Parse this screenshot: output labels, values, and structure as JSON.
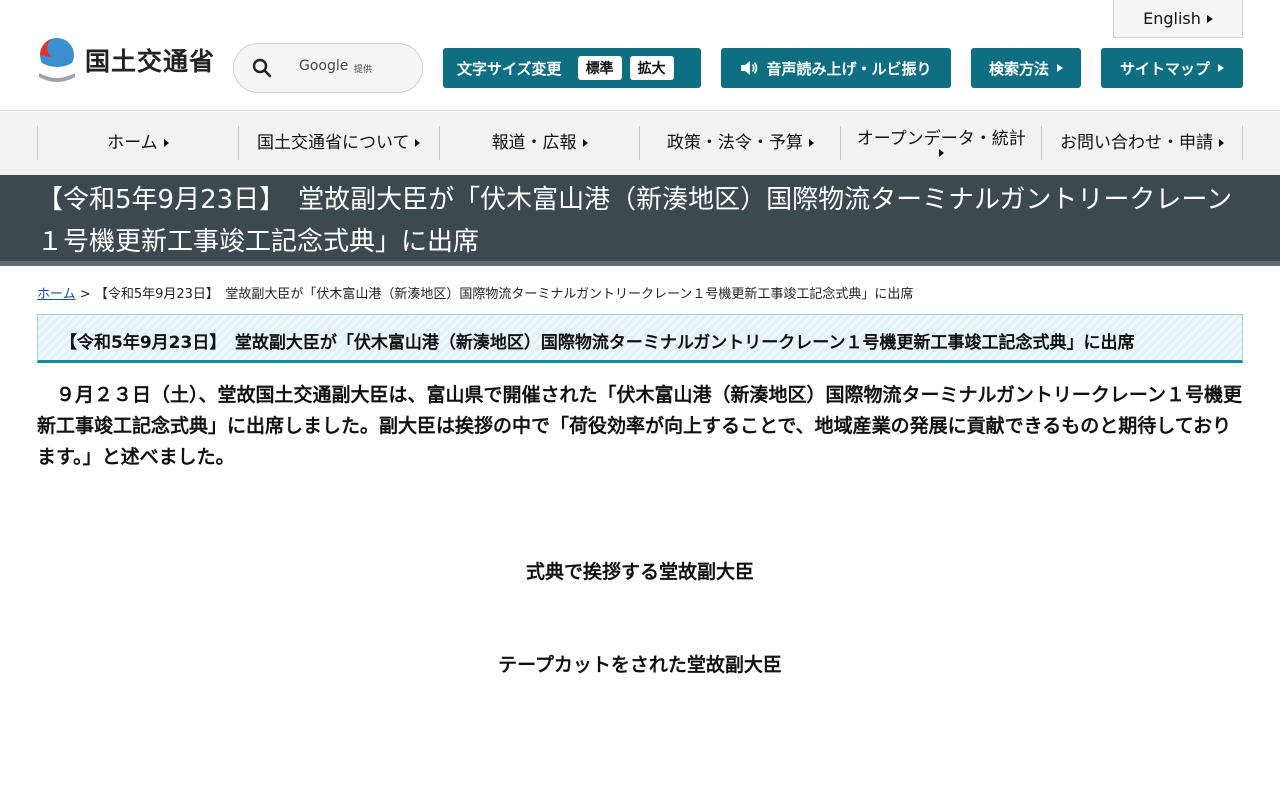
{
  "header": {
    "logo_text": "国土交通省",
    "search": {
      "brand": "Google",
      "provided": "提供"
    },
    "language_button": "English",
    "font_size": {
      "label": "文字サイズ変更",
      "standard": "標準",
      "large": "拡大"
    },
    "voice_button": "音声読み上げ・ルビ振り",
    "search_method_button": "検索方法",
    "sitemap_button": "サイトマップ"
  },
  "nav": {
    "items": [
      {
        "label": "ホーム"
      },
      {
        "label": "国土交通省について"
      },
      {
        "label": "報道・広報"
      },
      {
        "label": "政策・法令・予算"
      },
      {
        "label": "オープンデータ・統計"
      },
      {
        "label": "お問い合わせ・申請"
      }
    ]
  },
  "page": {
    "title": "【令和5年9月23日】　堂故副大臣が「伏木富山港（新湊地区）国際物流ターミナルガントリークレーン１号機更新工事竣工記念式典」に出席",
    "breadcrumb": {
      "home": "ホーム",
      "separator": ">",
      "current": "【令和5年9月23日】　堂故副大臣が「伏木富山港（新湊地区）国際物流ターミナルガントリークレーン１号機更新工事竣工記念式典」に出席"
    },
    "section_heading": "【令和5年9月23日】　堂故副大臣が「伏木富山港（新湊地区）国際物流ターミナルガントリークレーン１号機更新工事竣工記念式典」に出席",
    "body": "９月２３日（土）、堂故国土交通副大臣は、富山県で開催された「伏木富山港（新湊地区）国際物流ターミナルガントリークレーン１号機更新工事竣工記念式典」に出席しました。副大臣は挨拶の中で「荷役効率が向上することで、地域産業の発展に貢献できるものと期待しております。」と述べました。",
    "captions": [
      "式典で挨拶する堂故副大臣",
      "テープカットをされた堂故副大臣"
    ]
  },
  "colors": {
    "accent": "#0e6f83",
    "title_band": "#3c4a4f",
    "nav_background": "#f2f2f2",
    "link": "#1a4f9c"
  }
}
